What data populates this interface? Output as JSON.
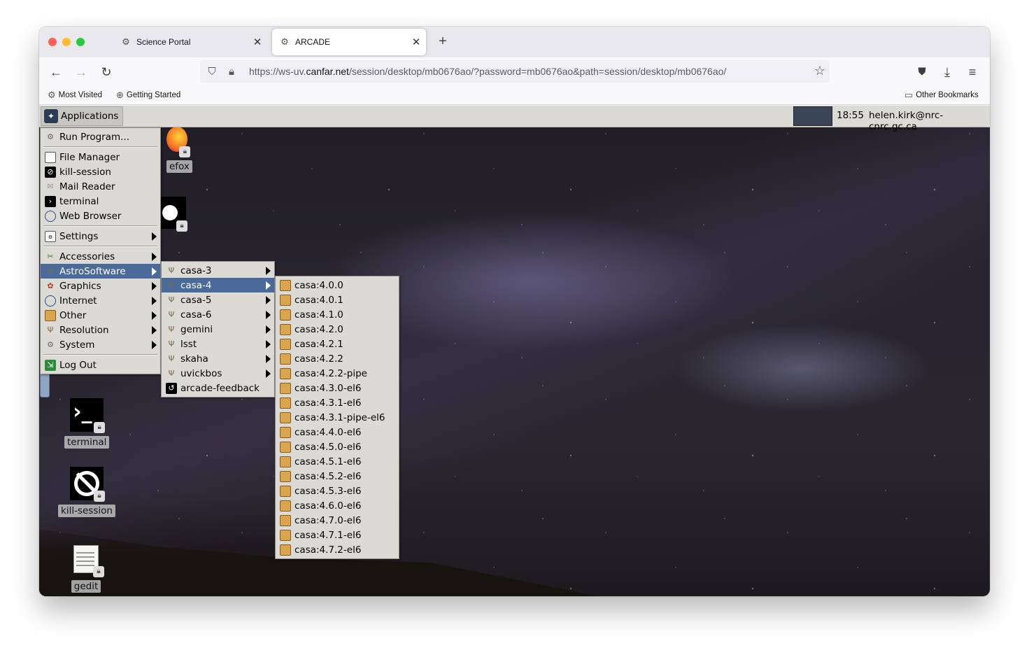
{
  "browser": {
    "tabs": [
      {
        "label": "Science Portal",
        "active": false
      },
      {
        "label": "ARCADE",
        "active": true
      }
    ],
    "url_prefix": "https://ws-uv.",
    "url_domain": "canfar.net",
    "url_rest": "/session/desktop/mb0676ao/?password=mb0676ao&path=session/desktop/mb0676ao/",
    "bookmarks": [
      "Most Visited",
      "Getting Started"
    ],
    "other_bookmarks": "Other Bookmarks"
  },
  "panel": {
    "applications_label": "Applications",
    "clock": "18:55",
    "user": "helen.kirk@nrc-cnrc.gc.ca"
  },
  "desktop_icons": {
    "firefox": "efox",
    "terminal": "terminal",
    "kill_session": "kill-session",
    "gedit": "gedit"
  },
  "app_menu": {
    "run_program": "Run Program...",
    "file_manager": "File Manager",
    "kill_session": "kill-session",
    "mail_reader": "Mail Reader",
    "terminal": "terminal",
    "web_browser": "Web Browser",
    "settings": "Settings",
    "accessories": "Accessories",
    "astrosoftware": "AstroSoftware",
    "graphics": "Graphics",
    "internet": "Internet",
    "other": "Other",
    "resolution": "Resolution",
    "system": "System",
    "log_out": "Log Out"
  },
  "astro_menu": [
    "casa-3",
    "casa-4",
    "casa-5",
    "casa-6",
    "gemini",
    "lsst",
    "skaha",
    "uvickbos",
    "arcade-feedback"
  ],
  "casa4_menu": [
    "casa:4.0.0",
    "casa:4.0.1",
    "casa:4.1.0",
    "casa:4.2.0",
    "casa:4.2.1",
    "casa:4.2.2",
    "casa:4.2.2-pipe",
    "casa:4.3.0-el6",
    "casa:4.3.1-el6",
    "casa:4.3.1-pipe-el6",
    "casa:4.4.0-el6",
    "casa:4.5.0-el6",
    "casa:4.5.1-el6",
    "casa:4.5.2-el6",
    "casa:4.5.3-el6",
    "casa:4.6.0-el6",
    "casa:4.7.0-el6",
    "casa:4.7.1-el6",
    "casa:4.7.2-el6"
  ],
  "colors": {
    "selected": "#4a6a9a",
    "panel": "#dcdad5"
  }
}
